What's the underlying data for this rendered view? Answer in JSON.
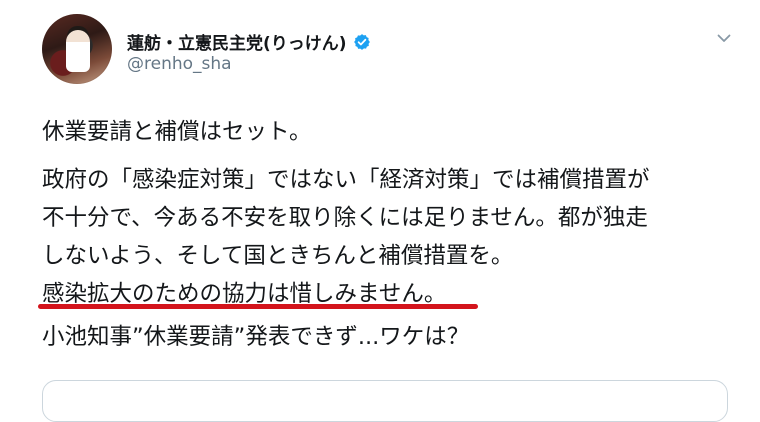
{
  "tweet": {
    "author": {
      "display_name": "蓮舫・立憲民主党(りっけん)",
      "handle": "@renho_sha",
      "verified": true,
      "avatar_icon": "profile-photo"
    },
    "menu_icon": "chevron-down-icon",
    "lines": {
      "headline": "休業要請と補償はセット。",
      "p2_line1": "政府の「感染症対策」ではない「経済対策」では補償措置が",
      "p2_line2": "不十分で、今ある不安を取り除くには足りません。都が独走",
      "p2_line3": "しないよう、そして国ときちんと補償措置を。",
      "p2_line4": "感染拡大のための協力は惜しみません。",
      "quote_line": "小池知事”休業要請”発表できず...ワケは？"
    },
    "colors": {
      "verified_badge": "#1da1f2",
      "underline": "#d3141c",
      "handle_text": "#657786",
      "card_border": "#ccd6dd"
    }
  }
}
